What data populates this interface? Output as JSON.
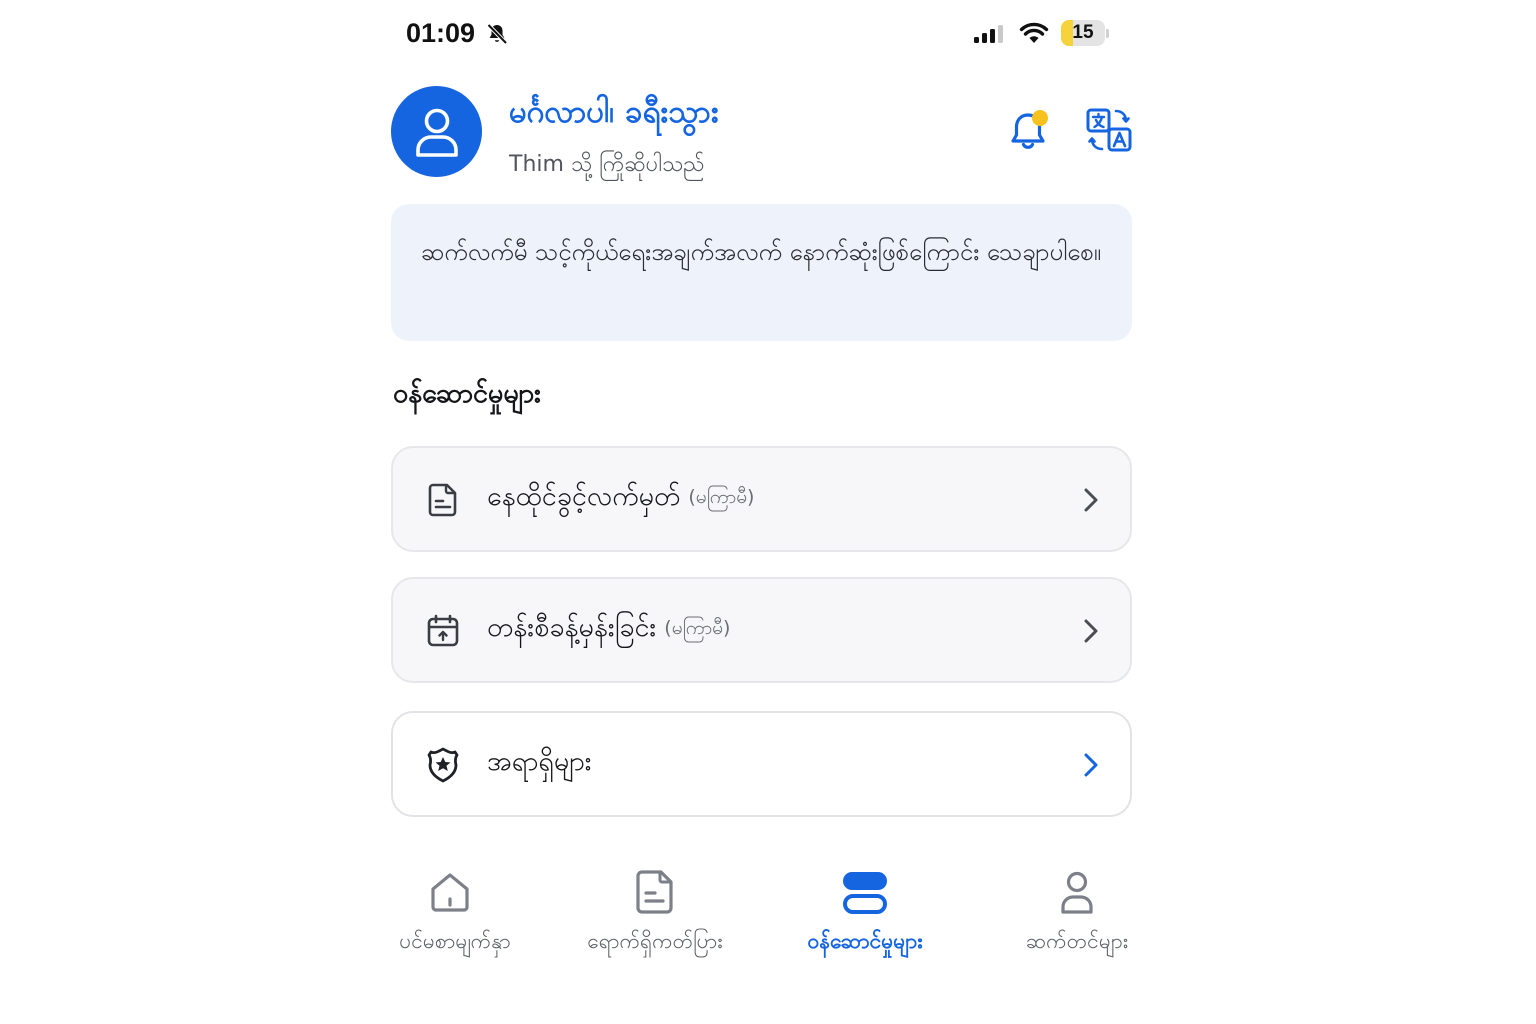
{
  "status_bar": {
    "time": "01:09",
    "battery": "15",
    "battery_level": 0.15
  },
  "header": {
    "greeting": "မင်္ဂလာပါ၊ ခရီးသွား",
    "subtitle": "Thim သို့ ကြိုဆိုပါသည်",
    "avatar_icon": "user-icon",
    "notification_icon": "bell-icon",
    "translate_icon": "translate-icon",
    "notification_dot_color": "#f7c21e"
  },
  "notice": {
    "text": "ဆက်လက်မီ သင့်ကိုယ်ရေးအချက်အလက် နောက်ဆုံးဖြစ်ကြောင်း သေချာပါစေ။"
  },
  "services": {
    "title": "ဝန်ဆောင်မှုများ",
    "items": [
      {
        "label": "နေထိုင်ခွင့်လက်မှတ်",
        "tag": "(မကြာမီ)",
        "icon": "document-icon"
      },
      {
        "label": "တန်းစီခန့်မှန်းခြင်း",
        "tag": "(မကြာမီ)",
        "icon": "calendar-icon"
      },
      {
        "label": "အရာရှိများ",
        "tag": "",
        "icon": "police-badge-icon"
      }
    ]
  },
  "bottom_nav": {
    "items": [
      {
        "label": "ပင်မစာမျက်နှာ",
        "icon": "home-icon"
      },
      {
        "label": "ရောက်ရှိကတ်ပြား",
        "icon": "card-document-icon"
      },
      {
        "label": "ဝန်ဆောင်မှုများ",
        "icon": "services-icon",
        "active": true
      },
      {
        "label": "ဆက်တင်များ",
        "icon": "profile-icon"
      }
    ]
  },
  "colors": {
    "accent": "#1565e0",
    "notice_bg": "#eef3fb"
  }
}
